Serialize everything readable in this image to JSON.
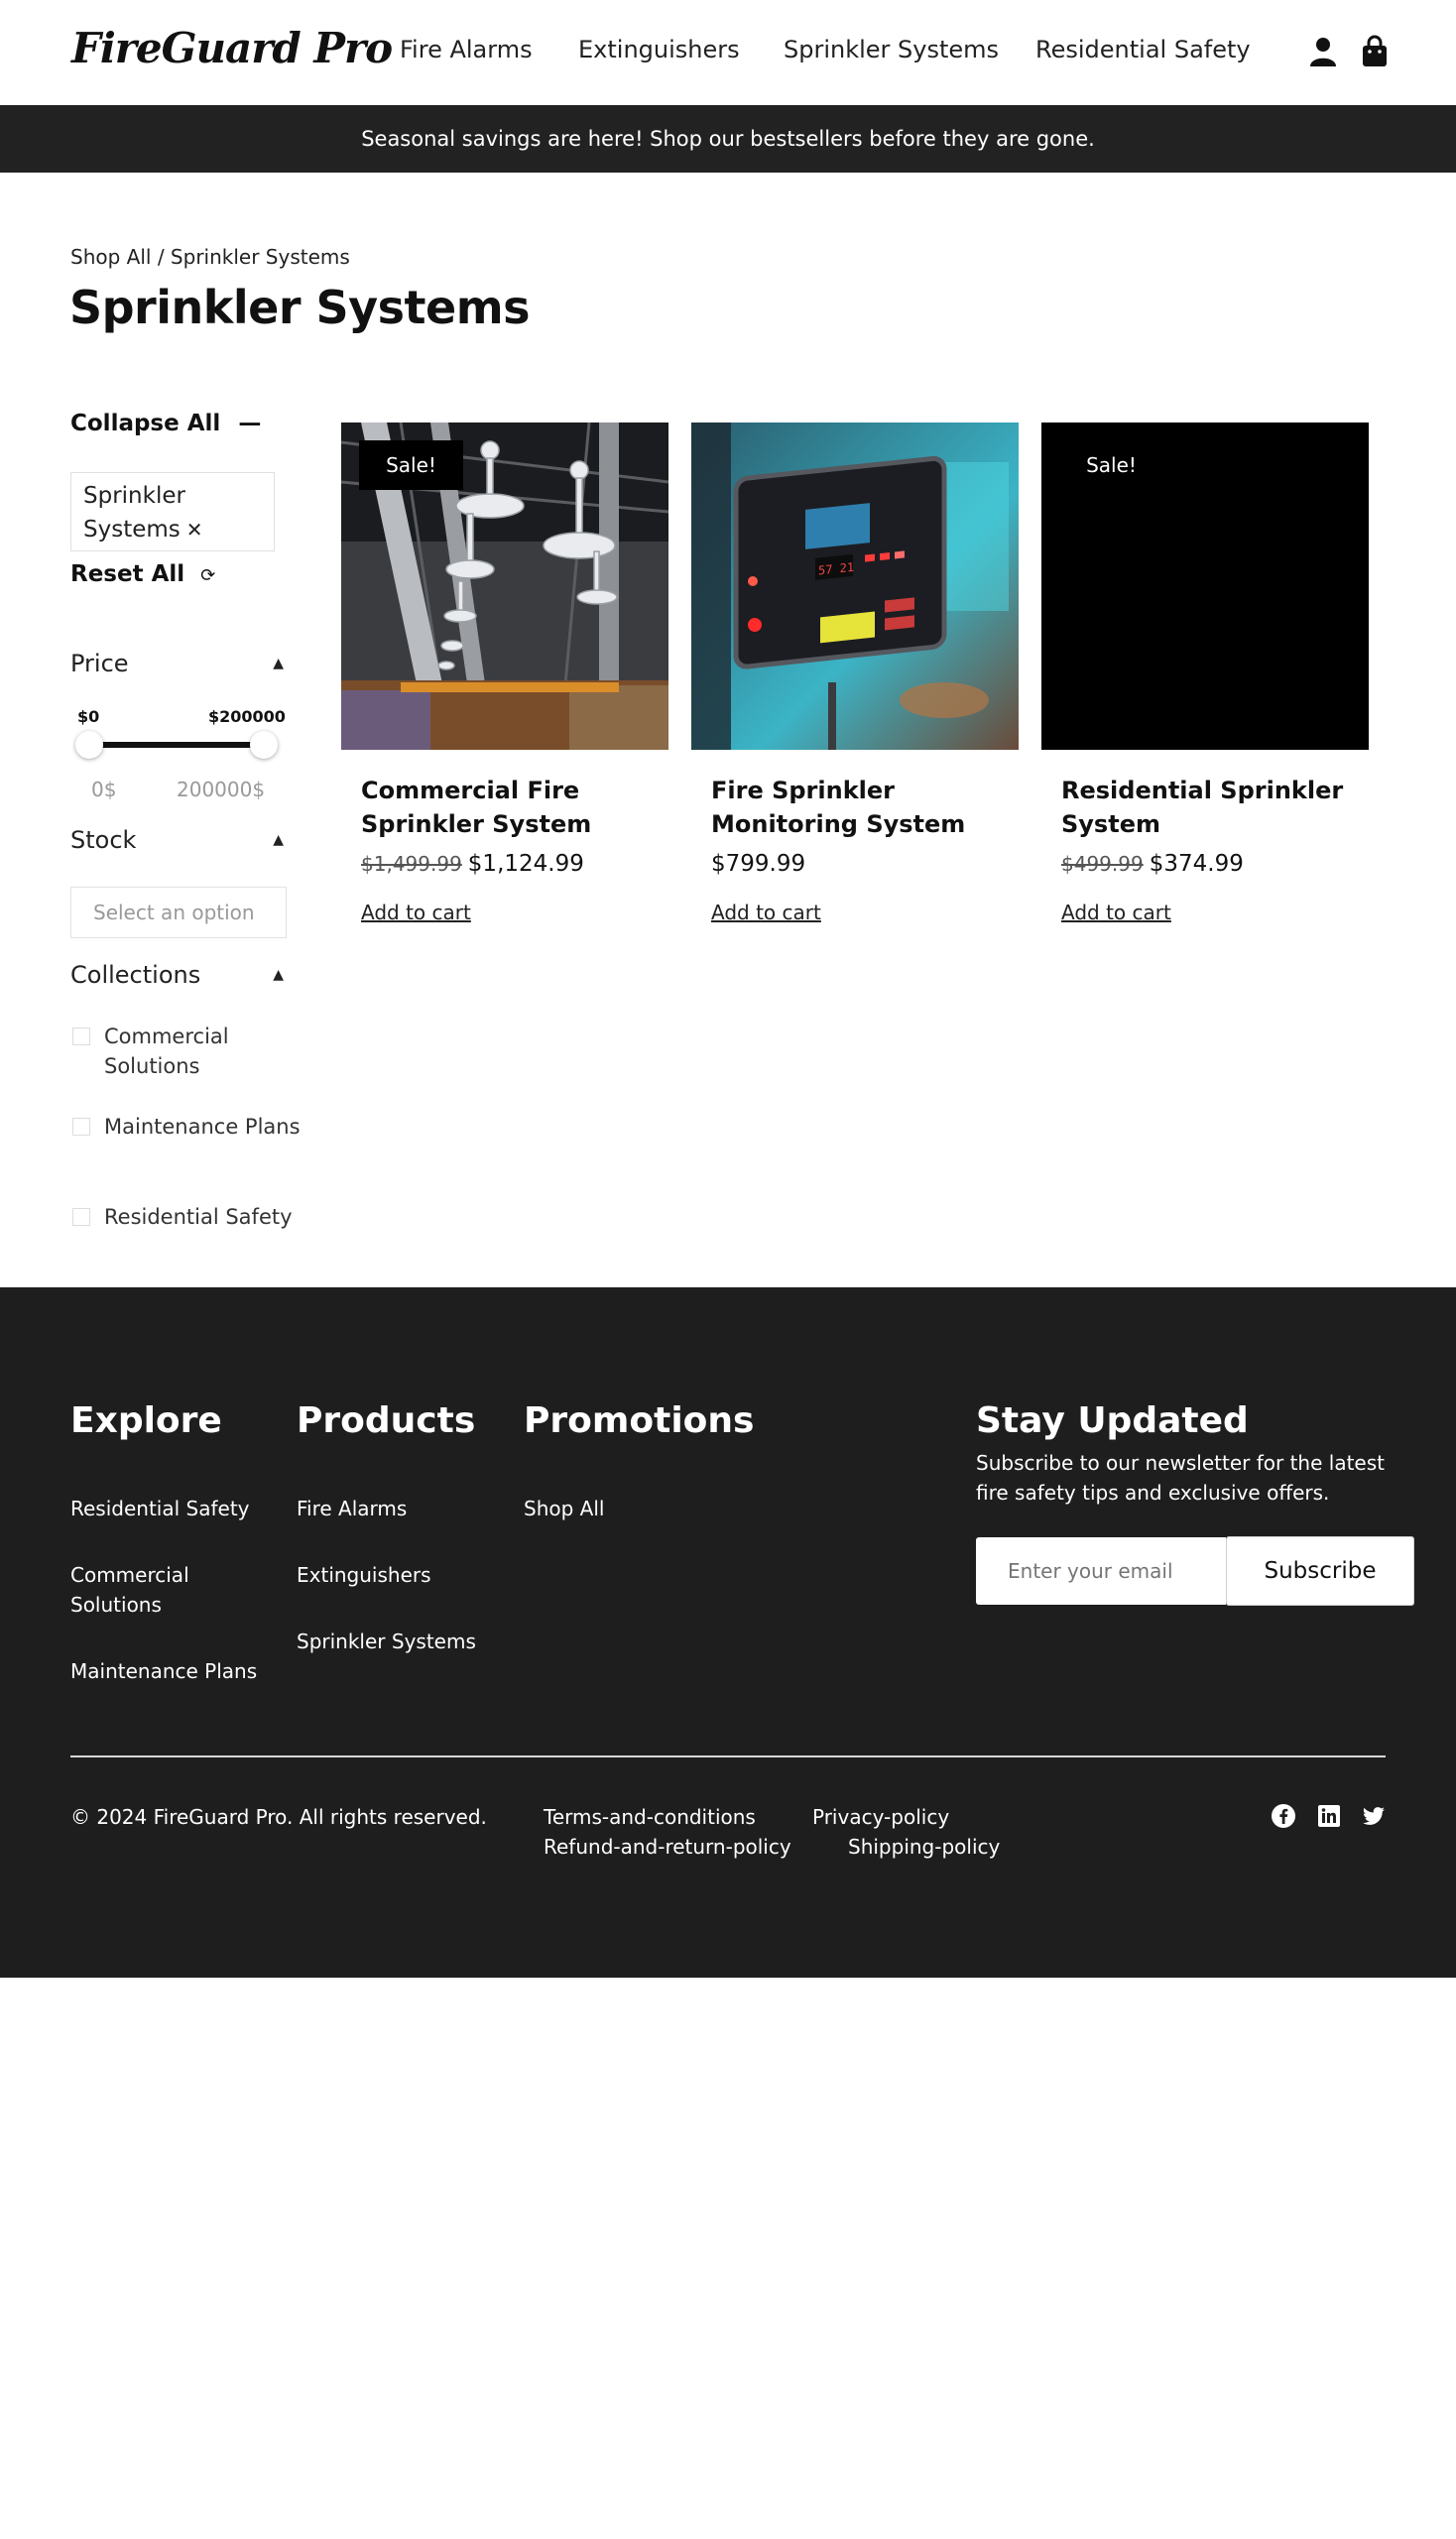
{
  "header": {
    "logo": "FireGuard Pro",
    "nav": [
      "Fire Alarms",
      "Extinguishers",
      "Sprinkler Systems",
      "Residential Safety"
    ],
    "icons": [
      "user-icon",
      "shopping-bag-icon"
    ]
  },
  "announcement": "Seasonal savings are here! Shop our bestsellers before they are gone.",
  "breadcrumb": {
    "parent": "Shop All",
    "separator": " / ",
    "current": "Sprinkler Systems"
  },
  "page_title": "Sprinkler Systems",
  "sidebar": {
    "collapse_all": "Collapse All",
    "active_filter": "Sprinkler Systems",
    "reset_all": "Reset All",
    "price": {
      "label": "Price",
      "min_label": "$0",
      "max_label": "$200000",
      "min_value": "0$",
      "max_value": "200000$",
      "range_min_fraction": 0,
      "range_max_fraction": 1
    },
    "stock": {
      "label": "Stock",
      "placeholder": "Select an option"
    },
    "collections": {
      "label": "Collections",
      "items": [
        "Commercial Solutions",
        "Maintenance Plans",
        "Residential Safety"
      ]
    }
  },
  "products": [
    {
      "title": "Commercial Fire Sprinkler System",
      "badge": "Sale!",
      "old_price": "$1,499.99",
      "price": "$1,124.99",
      "cta": "Add to cart"
    },
    {
      "title": "Fire Sprinkler Monitoring System",
      "badge": "",
      "old_price": "",
      "price": "$799.99",
      "cta": "Add to cart"
    },
    {
      "title": "Residential Sprinkler System",
      "badge": "Sale!",
      "old_price": "$499.99",
      "price": "$374.99",
      "cta": "Add to cart"
    }
  ],
  "footer": {
    "explore": {
      "heading": "Explore",
      "links": [
        "Residential Safety",
        "Commercial Solutions",
        "Maintenance Plans"
      ]
    },
    "products": {
      "heading": "Products",
      "links": [
        "Fire Alarms",
        "Extinguishers",
        "Sprinkler Systems"
      ]
    },
    "promotions": {
      "heading": "Promotions",
      "links": [
        "Shop All"
      ]
    },
    "newsletter": {
      "heading": "Stay Updated",
      "text": "Subscribe to our newsletter for the latest fire safety tips and exclusive offers.",
      "placeholder": "Enter your email",
      "button": "Subscribe"
    },
    "copyright": "© 2024 FireGuard Pro. All rights reserved.",
    "legal": [
      "Terms-and-conditions",
      "Privacy-policy",
      "Refund-and-return-policy",
      "Shipping-policy"
    ],
    "social": [
      "facebook-icon",
      "linkedin-icon",
      "twitter-icon"
    ]
  },
  "colors": {
    "dark": "#222222",
    "footer_bg": "#1e1e1e",
    "sale_badge": "#000000"
  }
}
